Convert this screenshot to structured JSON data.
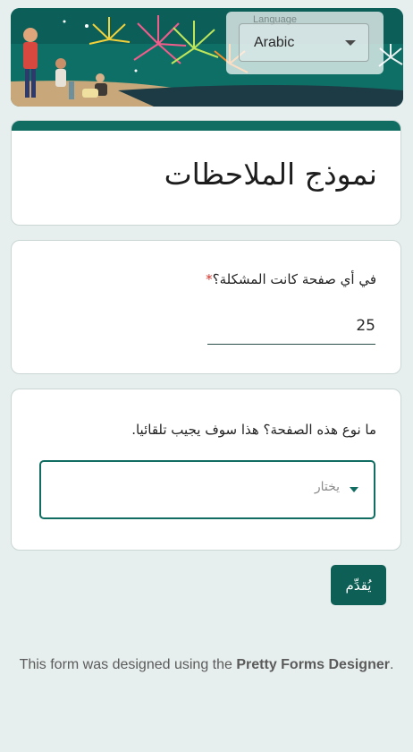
{
  "language": {
    "legend": "Language",
    "selected": "Arabic"
  },
  "form": {
    "title": "نموذج الملاحظات"
  },
  "questions": [
    {
      "label": "في أي صفحة كانت المشكلة؟",
      "required_mark": "*",
      "value": "25"
    },
    {
      "label": "ما نوع هذه الصفحة؟ هذا سوف يجيب تلقائيا.",
      "placeholder": "يختار"
    }
  ],
  "submit": {
    "label": "يُقدِّم"
  },
  "footer": {
    "prefix": "This form was designed using the ",
    "brand": "Pretty Forms Designer",
    "suffix": "."
  },
  "colors": {
    "accent": "#116d61",
    "page_bg": "#e7efee",
    "required": "#d93025"
  }
}
